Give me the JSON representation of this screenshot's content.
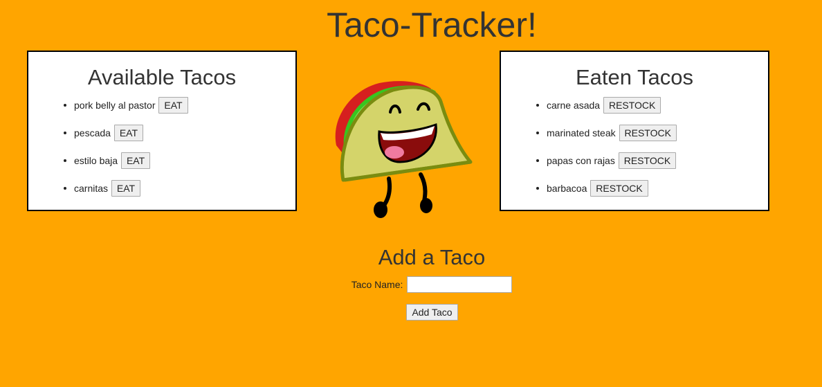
{
  "header": {
    "title": "Taco-Tracker!"
  },
  "available": {
    "heading": "Available Tacos",
    "button_label": "EAT",
    "items": [
      {
        "name": "pork belly al pastor"
      },
      {
        "name": "pescada"
      },
      {
        "name": "estilo baja"
      },
      {
        "name": "carnitas"
      }
    ]
  },
  "eaten": {
    "heading": "Eaten Tacos",
    "button_label": "RESTOCK",
    "items": [
      {
        "name": "carne asada"
      },
      {
        "name": "marinated steak"
      },
      {
        "name": "papas con rajas"
      },
      {
        "name": "barbacoa"
      }
    ]
  },
  "add_form": {
    "heading": "Add a Taco",
    "name_label": "Taco Name:",
    "name_value": "",
    "submit_label": "Add Taco"
  },
  "illustration": {
    "icon": "smiling-taco-icon"
  },
  "colors": {
    "background": "#FFA500",
    "panel": "#ffffff",
    "text": "#333333"
  }
}
